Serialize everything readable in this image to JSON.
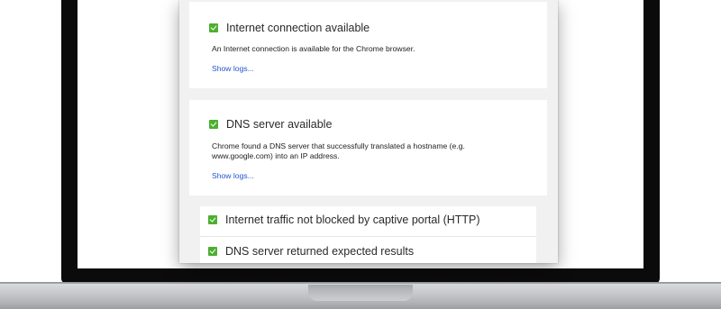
{
  "checks": {
    "internet": {
      "title": "Internet connection available",
      "description": "An Internet connection is available for the Chrome browser.",
      "link": "Show logs..."
    },
    "dns": {
      "title": "DNS server available",
      "description_line1": "Chrome found a DNS server that successfully translated a hostname (e.g.",
      "description_line2": "www.google.com) into an IP address.",
      "link": "Show logs..."
    },
    "captive_portal": {
      "title": "Internet traffic not blocked by captive portal (HTTP)"
    },
    "dns_results": {
      "title": "DNS server returned expected results"
    }
  },
  "colors": {
    "check_green": "#4caf2f",
    "link_blue": "#2255cc"
  }
}
